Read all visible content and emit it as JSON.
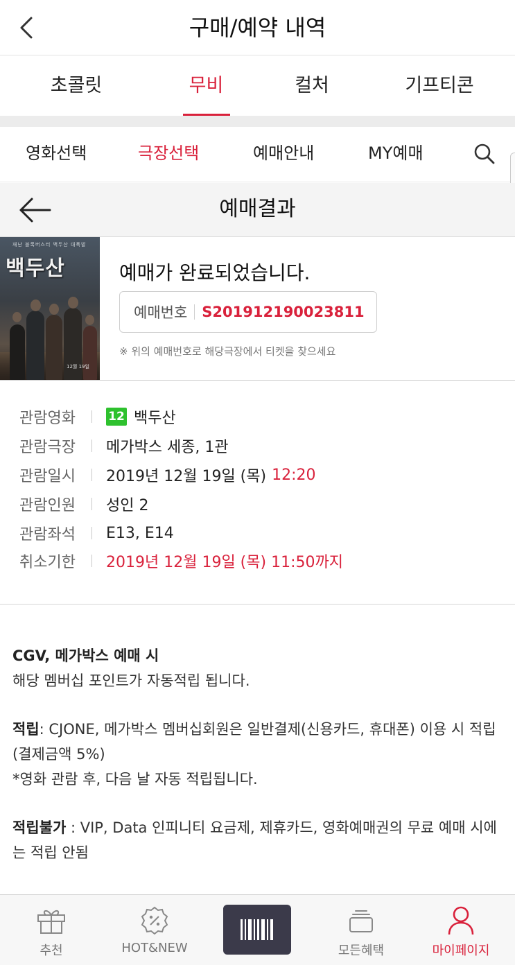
{
  "header": {
    "title": "구매/예약 내역"
  },
  "category_tabs": [
    {
      "label": "초콜릿",
      "active": false
    },
    {
      "label": "무비",
      "active": true
    },
    {
      "label": "컬처",
      "active": false
    },
    {
      "label": "기프티콘",
      "active": false
    }
  ],
  "movie_nav": {
    "items": [
      {
        "label": "영화선택",
        "active": false
      },
      {
        "label": "극장선택",
        "active": true
      },
      {
        "label": "예매안내",
        "active": false
      },
      {
        "label": "MY예매",
        "active": false
      }
    ]
  },
  "result_bar": {
    "title": "예매결과"
  },
  "poster": {
    "title": "백두산",
    "tagline": "재난 블록버스터 백두산 대폭발",
    "date": "12월 19일"
  },
  "summary": {
    "message": "예매가 완료되었습니다.",
    "reservation_label": "예매번호",
    "reservation_number": "S201912190023811",
    "notice": "※ 위의 예매번호로 해당극장에서 티켓을 찾으세요"
  },
  "details": {
    "movie": {
      "label": "관람영화",
      "rating": "12",
      "value": "백두산"
    },
    "theater": {
      "label": "관람극장",
      "value": "메가박스 세종, 1관"
    },
    "datetime": {
      "label": "관람일시",
      "value": "2019년 12월 19일 (목)",
      "time": "12:20"
    },
    "people": {
      "label": "관람인원",
      "value": "성인 2"
    },
    "seats": {
      "label": "관람좌석",
      "value": "E13, E14"
    },
    "cancel": {
      "label": "취소기한",
      "value": "2019년 12월 19일 (목) 11:50까지"
    }
  },
  "info": {
    "heading": "CGV, 메가박스 예매 시",
    "line1": "해당 멤버십 포인트가 자동적립 됩니다.",
    "accrue_label": "적립",
    "accrue_text": ": CJONE, 메가박스 멤버십회원은 일반결제(신용카드, 휴대폰) 이용 시 적립(결제금액 5%)",
    "accrue_note": "*영화 관람 후, 다음 날 자동 적립됩니다.",
    "no_accrue_label": "적립불가",
    "no_accrue_text": " : VIP, Data 인피니티 요금제, 제휴카드, 영화예매권의 무료 예매 시에는 적립 안됨"
  },
  "bottom_nav": [
    {
      "label": "추천",
      "icon": "gift-icon"
    },
    {
      "label": "HOT&NEW",
      "icon": "discount-badge-icon"
    },
    {
      "label": "",
      "icon": "barcode-icon"
    },
    {
      "label": "모든혜택",
      "icon": "benefits-stack-icon"
    },
    {
      "label": "마이페이지",
      "icon": "person-icon",
      "active": true
    }
  ],
  "colors": {
    "accent": "#d9213b",
    "rating_green": "#2ec12e",
    "barcode_bg": "#3b3a4a"
  }
}
